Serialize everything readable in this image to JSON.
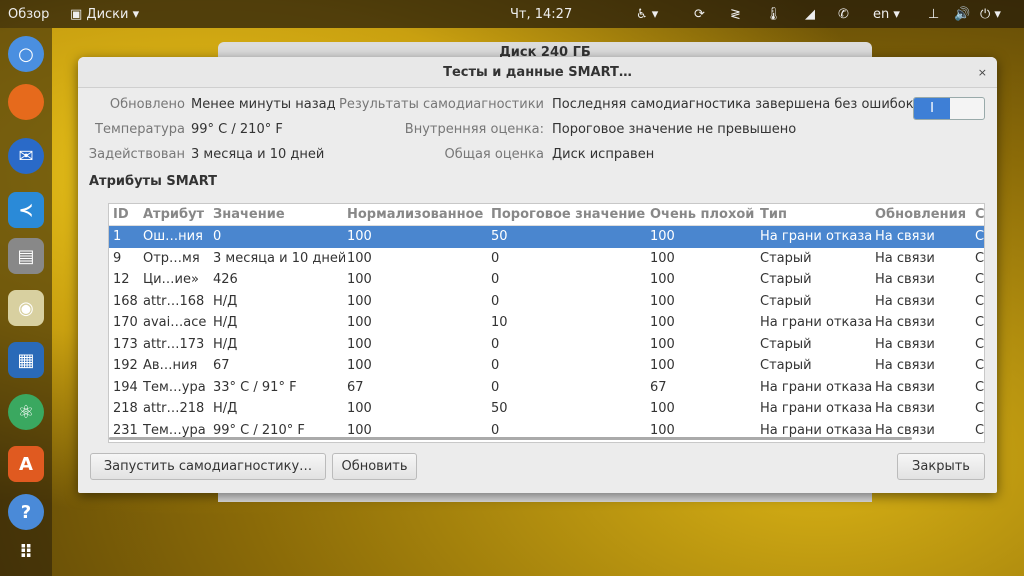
{
  "topbar": {
    "overview": "Обзор",
    "app": "Диски ▾",
    "clock": "Чт, 14:27",
    "lang": "en ▾"
  },
  "back_window": {
    "title": "Диск 240 ГБ"
  },
  "dialog": {
    "title": "Тесты и данные SMART…",
    "close": "×",
    "info": {
      "updated_label": "Обновлено",
      "updated": "Менее минуты назад",
      "temp_label": "Температура",
      "temp": "99° C / 210° F",
      "powered_label": "Задействован",
      "powered": "3 месяца и 10 дней",
      "selftest_label": "Результаты самодиагностики",
      "selftest": "Последняя самодиагностика завершена без ошибок",
      "internal_label": "Внутренняя оценка:",
      "internal": "Пороговое значение не превышено",
      "overall_label": "Общая оценка",
      "overall": "Диск исправен"
    },
    "smart_toggle": {
      "on": true,
      "label": "I"
    },
    "section": "Атрибуты SMART",
    "columns": [
      "ID",
      "Атрибут",
      "Значение",
      "Нормализованное",
      "Пороговое значение",
      "Очень плохой",
      "Тип",
      "Обновления",
      "С"
    ],
    "rows": [
      [
        "1",
        "Ош…ния",
        "0",
        "100",
        "50",
        "100",
        "На грани отказа",
        "На связи",
        "С"
      ],
      [
        "9",
        "Отр…мя",
        "3 месяца и 10 дней",
        "100",
        "0",
        "100",
        "Старый",
        "На связи",
        "С"
      ],
      [
        "12",
        "Ци…ие»",
        "426",
        "100",
        "0",
        "100",
        "Старый",
        "На связи",
        "С"
      ],
      [
        "168",
        "attr…168",
        "Н/Д",
        "100",
        "0",
        "100",
        "Старый",
        "На связи",
        "С"
      ],
      [
        "170",
        "avai…ace",
        "Н/Д",
        "100",
        "10",
        "100",
        "На грани отказа",
        "На связи",
        "С"
      ],
      [
        "173",
        "attr…173",
        "Н/Д",
        "100",
        "0",
        "100",
        "Старый",
        "На связи",
        "С"
      ],
      [
        "192",
        "Ав…ния",
        "67",
        "100",
        "0",
        "100",
        "Старый",
        "На связи",
        "С"
      ],
      [
        "194",
        "Тем…ура",
        "33° C / 91° F",
        "67",
        "0",
        "67",
        "На грани отказа",
        "На связи",
        "С"
      ],
      [
        "218",
        "attr…218",
        "Н/Д",
        "100",
        "50",
        "100",
        "На грани отказа",
        "На связи",
        "С"
      ],
      [
        "231",
        "Тем…ура",
        "99° C / 210° F",
        "100",
        "0",
        "100",
        "На грани отказа",
        "На связи",
        "С"
      ]
    ],
    "buttons": {
      "selftest": "Запустить самодиагностику…",
      "refresh": "Обновить",
      "close": "Закрыть"
    }
  }
}
